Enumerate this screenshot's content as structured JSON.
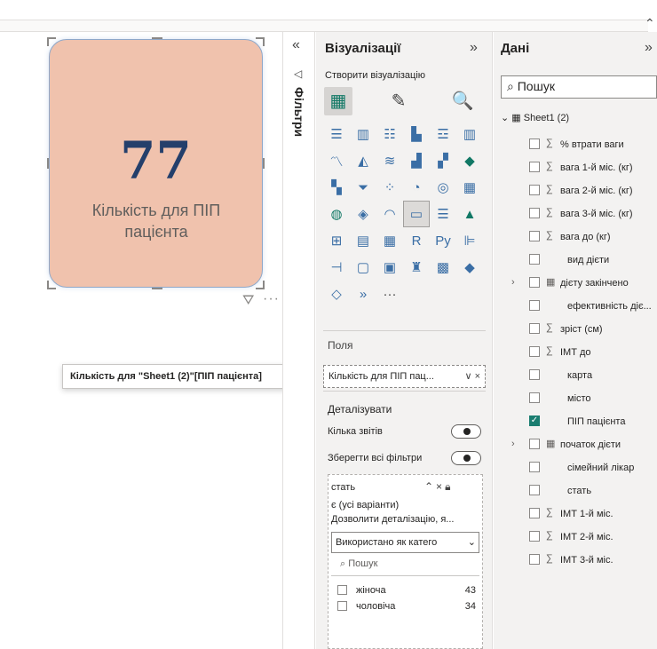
{
  "canvas": {
    "card": {
      "value": "77",
      "label": "Кількість для ПІП пацієнта"
    },
    "tooltip": "Кількість для \"Sheet1 (2)\"[ПІП пацієнта]",
    "filter_icon": "filter-icon",
    "more_icon": "more-options-icon"
  },
  "filters_pane": {
    "label": "Фільтри"
  },
  "viz_pane": {
    "title": "Візуалізації",
    "build_label": "Створити візуалізацію",
    "fields_label": "Поля",
    "field_pill": "Кількість для ПІП пац...",
    "drillthrough_title": "Деталізувати",
    "cross_report_label": "Кілька звітів",
    "keep_filters_label": "Зберегти всі фільтри",
    "drill_field": {
      "name": "стать",
      "scope": "є (усі варіанти)",
      "description": "Дозволити деталізацію, я...",
      "select_value": "Використано як катего",
      "search_placeholder": "Пошук",
      "items": [
        {
          "label": "жіноча",
          "count": "43"
        },
        {
          "label": "чоловіча",
          "count": "34"
        }
      ]
    },
    "gallery_icons": [
      [
        "stacked-bar-icon",
        "clustered-bar-icon",
        "stacked-bar-100-icon",
        "stacked-column-icon",
        "clustered-column-icon",
        "stacked-column-100-icon"
      ],
      [
        "line-chart-icon",
        "area-chart-icon",
        "stacked-area-icon",
        "line-column-icon",
        "line-clustered-column-icon",
        "ribbon-chart-icon"
      ],
      [
        "waterfall-icon",
        "funnel-icon",
        "scatter-icon",
        "pie-chart-icon",
        "donut-chart-icon",
        "treemap-icon"
      ],
      [
        "map-icon",
        "filled-map-icon",
        "gauge-icon",
        "card-icon",
        "multi-row-card-icon",
        "kpi-icon"
      ],
      [
        "slicer-icon",
        "table-icon",
        "matrix-icon",
        "r-visual-icon",
        "python-visual-icon",
        "key-influencers-icon"
      ],
      [
        "decomposition-tree-icon",
        "qa-icon",
        "narrative-icon",
        "metrics-icon",
        "paginated-report-icon",
        "power-apps-icon"
      ],
      [
        "power-automate-icon",
        "smart-narrative-icon",
        "more-visuals-icon"
      ]
    ]
  },
  "data_pane": {
    "title": "Дані",
    "search_placeholder": "Пошук",
    "table": "Sheet1 (2)",
    "fields": [
      {
        "label": "% втрати ваги",
        "sigma": true,
        "checked": false
      },
      {
        "label": "вага 1-й міс. (кг)",
        "sigma": true,
        "checked": false
      },
      {
        "label": "вага 2-й міс. (кг)",
        "sigma": true,
        "checked": false
      },
      {
        "label": "вага 3-й міс. (кг)",
        "sigma": true,
        "checked": false
      },
      {
        "label": "вага до (кг)",
        "sigma": true,
        "checked": false
      },
      {
        "label": "вид дієти",
        "sigma": false,
        "checked": false
      },
      {
        "label": "дієту закінчено",
        "sigma": false,
        "date": true,
        "checked": false
      },
      {
        "label": "ефективність діє...",
        "sigma": false,
        "checked": false
      },
      {
        "label": "зріст (см)",
        "sigma": true,
        "checked": false
      },
      {
        "label": "ІМТ до",
        "sigma": true,
        "checked": false
      },
      {
        "label": "карта",
        "sigma": false,
        "checked": false
      },
      {
        "label": "місто",
        "sigma": false,
        "checked": false
      },
      {
        "label": "ПІП пацієнта",
        "sigma": false,
        "checked": true
      },
      {
        "label": "початок дієти",
        "sigma": false,
        "date": true,
        "checked": false
      },
      {
        "label": "сімейний лікар",
        "sigma": false,
        "checked": false
      },
      {
        "label": "стать",
        "sigma": false,
        "checked": false
      },
      {
        "label": "ІМТ 1-й міс.",
        "sigma": true,
        "checked": false
      },
      {
        "label": "ІМТ 2-й міс.",
        "sigma": true,
        "checked": false
      },
      {
        "label": "ІМТ 3-й міс.",
        "sigma": true,
        "checked": false
      }
    ]
  }
}
